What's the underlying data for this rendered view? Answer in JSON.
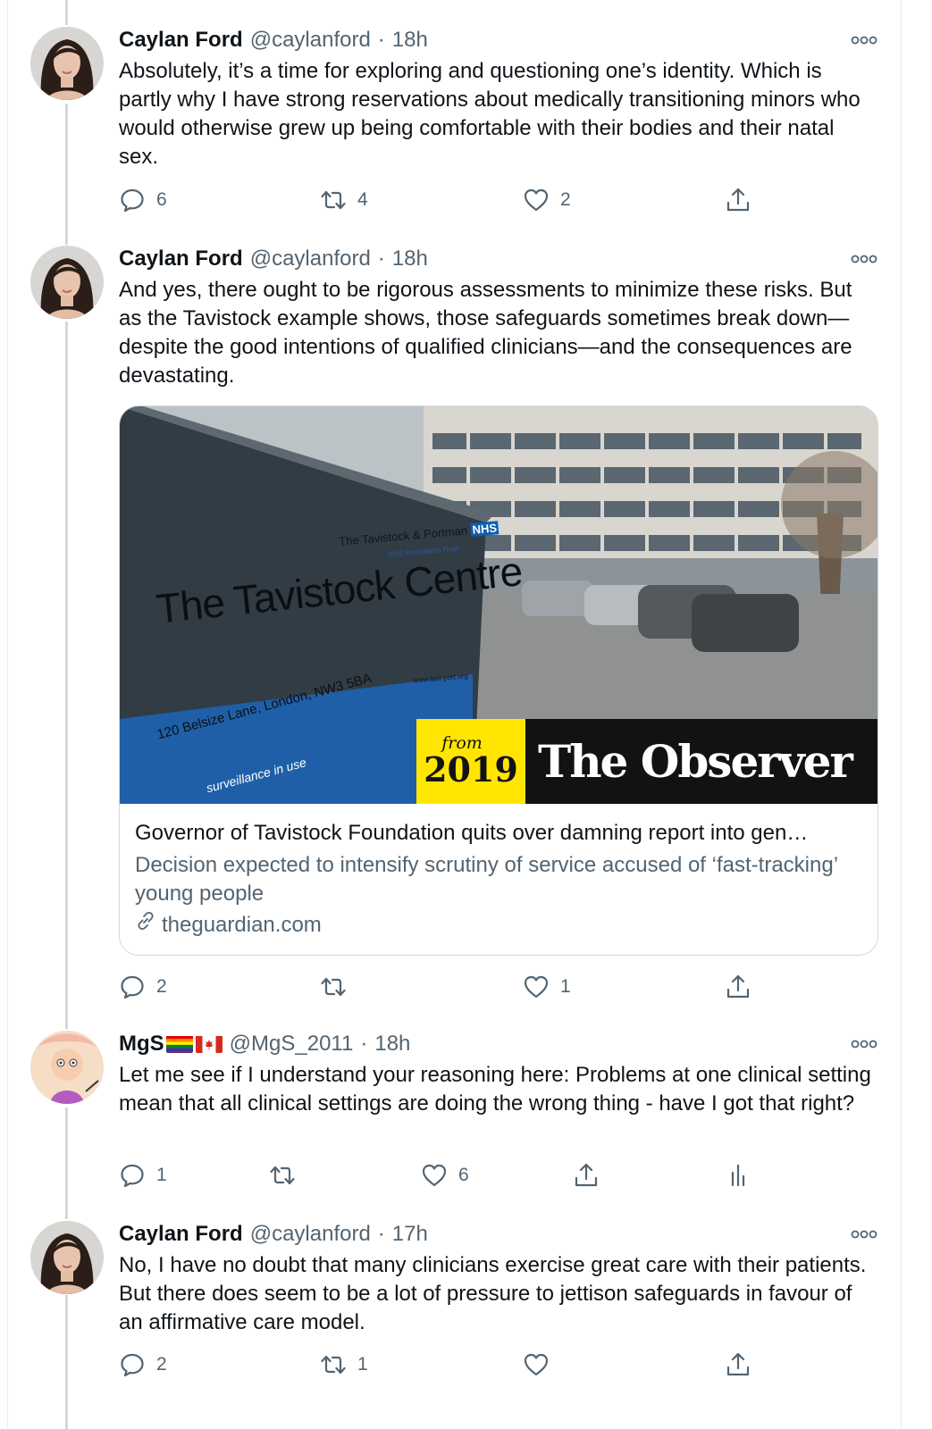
{
  "tweets": [
    {
      "name": "Caylan Ford",
      "handle": "@caylanford",
      "time": "18h",
      "text": "Absolutely, it’s a time for exploring and questioning one’s identity. Which is partly why I have strong reservations about medically transitioning minors who would otherwise grew up being comfortable with their bodies and their natal sex.",
      "replies": "6",
      "retweets": "4",
      "likes": "2"
    },
    {
      "name": "Caylan Ford",
      "handle": "@caylanford",
      "time": "18h",
      "text": "And yes, there ought to be rigorous assessments to minimize these risks. But as the Tavistock example shows, those safeguards sometimes break down—despite the good intentions of qualified clinicians—and the consequences are devastating.",
      "replies": "2",
      "retweets": "",
      "likes": "1",
      "card": {
        "title": "Governor of Tavistock Foundation quits over damning report into gen…",
        "description": "Decision expected to intensify scrutiny of service accused of ‘fast-tracking’ young people",
        "domain": "theguardian.com",
        "image": {
          "sign_trust": "The Tavistock & Portman",
          "sign_nhs": "NHS",
          "sign_foundation": "NHS Foundation Trust",
          "sign_title": "The Tavistock Centre",
          "sign_web": "www.tavi-port.org",
          "sign_address": "120 Belsize Lane, London, NW3 5BA",
          "sign_surveillance": "surveillance in use",
          "badge_from": "from",
          "badge_year": "2019",
          "badge_brand": "The Observer"
        }
      }
    },
    {
      "name": "MgS",
      "handle": "@MgS_2011",
      "time": "18h",
      "text": "Let me see if I understand your reasoning here:  Problems at one clinical setting mean that all clinical settings are doing the wrong thing - have I got that right?",
      "replies": "1",
      "retweets": "",
      "likes": "6"
    },
    {
      "name": "Caylan Ford",
      "handle": "@caylanford",
      "time": "17h",
      "text": "No, I have no doubt that many clinicians exercise great care with their patients. But there does seem to be a lot of pressure to jettison safeguards in favour of an affirmative care model.",
      "replies": "2",
      "retweets": "1",
      "likes": ""
    }
  ],
  "separator": "·",
  "colors": {
    "text": "#0f1419",
    "secondary": "#536471",
    "thread_line": "#cfd9de",
    "observer_yellow": "#ffe500",
    "observer_black": "#121212"
  },
  "icons": [
    "reply-icon",
    "retweet-icon",
    "like-icon",
    "share-icon",
    "analytics-icon",
    "more-icon",
    "link-icon"
  ]
}
